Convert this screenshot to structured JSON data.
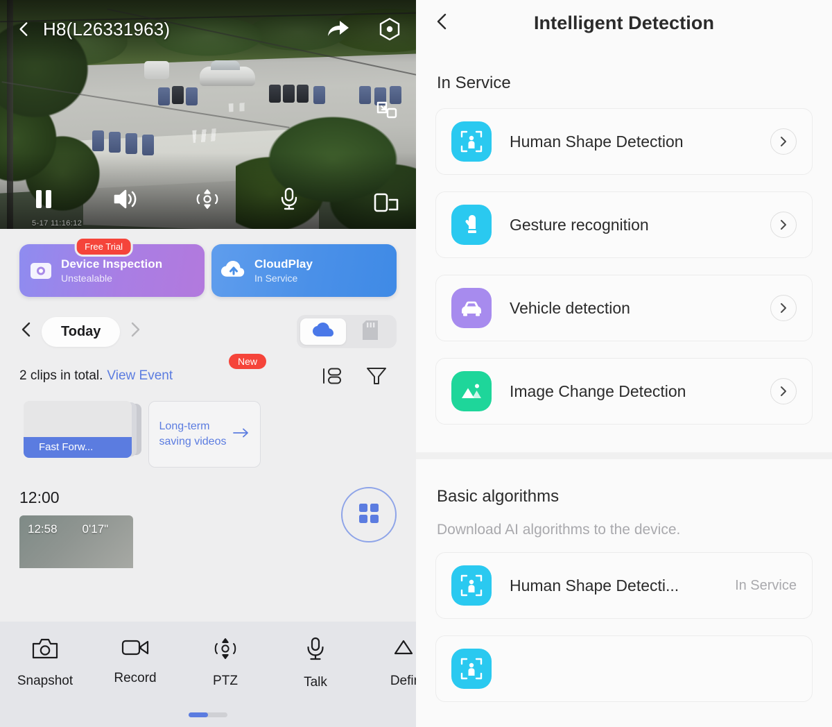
{
  "left": {
    "video": {
      "title": "H8(L26331963)",
      "timestamp": "5-17 11:16:12",
      "back_icon": "chevron-left-icon",
      "share_icon": "share-arrow-icon",
      "settings_icon": "hexagon-aperture-icon",
      "pip_icon": "picture-in-picture-icon",
      "multiscreen_icon": "multi-screen-icon",
      "controls": [
        {
          "name": "pause",
          "icon": "pause-icon"
        },
        {
          "name": "volume",
          "icon": "speaker-icon"
        },
        {
          "name": "ptz",
          "icon": "ptz-icon"
        },
        {
          "name": "talk",
          "icon": "microphone-icon"
        }
      ]
    },
    "services": [
      {
        "title": "Device Inspection",
        "subtitle": "Unstealable",
        "badge": "Free Trial",
        "icon": "camera-inspect-icon",
        "color": "#a98ae8"
      },
      {
        "title": "CloudPlay",
        "subtitle": "In Service",
        "icon": "cloud-upload-icon",
        "color": "#4a90e8"
      }
    ],
    "date_bar": {
      "prev_icon": "chevron-left-icon",
      "label": "Today",
      "next_icon": "chevron-right-icon",
      "storage": [
        {
          "name": "cloud",
          "icon": "cloud-icon",
          "active": true
        },
        {
          "name": "sdcard",
          "icon": "sd-card-icon",
          "active": false
        }
      ]
    },
    "clips": {
      "summary": "2 clips in total.",
      "link": "View Event",
      "badge": "New",
      "list_icon": "list-layout-icon",
      "filter_icon": "filter-funnel-icon",
      "fast_forward_label": "Fast Forw...",
      "long_term_line1": "Long-term",
      "long_term_line2": "saving videos",
      "long_term_arrow": "arrow-right-icon"
    },
    "timeline": {
      "hour_label": "12:00",
      "clip_time": "12:58",
      "clip_duration": "0'17\"",
      "grid_icon": "grid-four-squares-icon"
    },
    "toolbar": {
      "items": [
        {
          "label": "Snapshot",
          "icon": "camera-icon"
        },
        {
          "label": "Record",
          "icon": "video-camera-icon"
        },
        {
          "label": "PTZ",
          "icon": "ptz-icon"
        },
        {
          "label": "Talk",
          "icon": "microphone-icon"
        },
        {
          "label": "Defin",
          "icon": "definition-icon"
        }
      ]
    }
  },
  "right": {
    "header": {
      "back_icon": "chevron-left-icon",
      "title": "Intelligent Detection"
    },
    "in_service": {
      "title": "In Service",
      "items": [
        {
          "label": "Human Shape Detection",
          "icon": "human-shape-icon",
          "color": "#2ac9f0"
        },
        {
          "label": "Gesture recognition",
          "icon": "gesture-hand-icon",
          "color": "#2ac9f0"
        },
        {
          "label": "Vehicle detection",
          "icon": "vehicle-car-icon",
          "color": "#a78bee"
        },
        {
          "label": "Image Change Detection",
          "icon": "image-mountain-icon",
          "color": "#1ed69a"
        }
      ]
    },
    "basic": {
      "title": "Basic algorithms",
      "subtitle": "Download AI algorithms to the device.",
      "items": [
        {
          "label": "Human Shape Detecti...",
          "status": "In Service",
          "icon": "human-shape-icon",
          "color": "#2ac9f0"
        },
        {
          "label": "",
          "status": "",
          "icon": "human-shape-icon",
          "color": "#2ac9f0"
        }
      ]
    }
  }
}
